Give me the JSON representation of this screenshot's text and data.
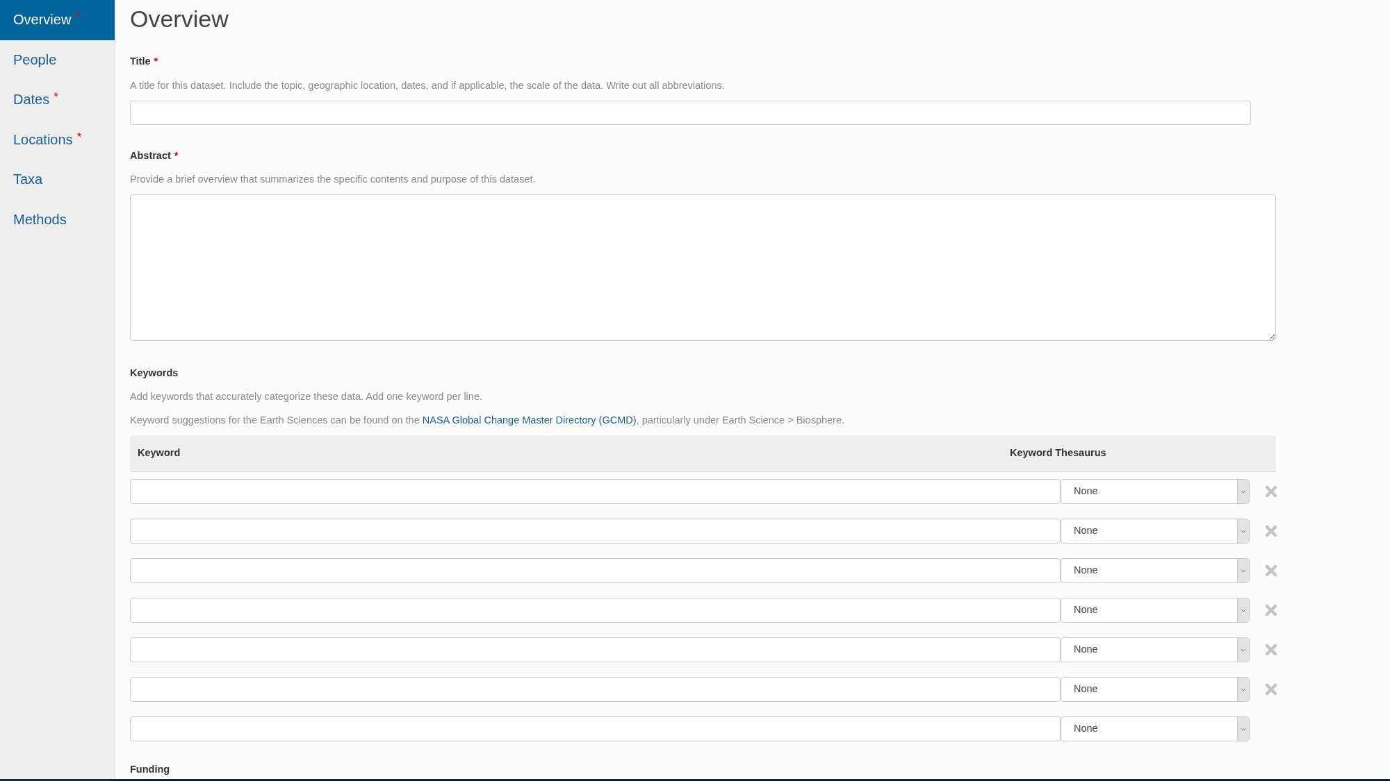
{
  "sidebar": {
    "items": [
      {
        "label": "Overview",
        "required_mark": "*",
        "selected": true
      },
      {
        "label": "People",
        "selected": false
      },
      {
        "label": "Dates",
        "required_mark": "*",
        "selected": false
      },
      {
        "label": "Locations",
        "required_mark": "*",
        "selected": false
      },
      {
        "label": "Taxa",
        "selected": false
      },
      {
        "label": "Methods",
        "selected": false
      }
    ]
  },
  "heading": "Overview",
  "fields": [
    {
      "kind": "input",
      "label": "Title",
      "required_mark": "*",
      "help": [
        "A title for this dataset. Include the topic, geographic location, dates, and if applicable, the scale of the data. Write out all abbreviations."
      ]
    },
    {
      "kind": "textarea",
      "label": "Abstract",
      "required_mark": "*",
      "help": [
        "Provide a brief overview that summarizes the specific contents and purpose of this dataset."
      ]
    }
  ],
  "keywords": {
    "label": "Keywords",
    "help": "Add keywords that accurately categorize these data. Add one keyword per line.",
    "suggestion": {
      "before": "Keyword suggestions for the Earth Sciences can be found on the ",
      "link": "NASA Global Change Master Directory (GCMD)",
      "after": ", particularly under Earth Science > Biosphere."
    },
    "columns": [
      "Keyword",
      "Keyword Thesaurus"
    ],
    "rows": [
      {
        "thesaurus": "None",
        "removable": true
      },
      {
        "thesaurus": "None",
        "removable": true
      },
      {
        "thesaurus": "None",
        "removable": true
      },
      {
        "thesaurus": "None",
        "removable": true
      },
      {
        "thesaurus": "None",
        "removable": true
      },
      {
        "thesaurus": "None",
        "removable": true
      },
      {
        "thesaurus": "None"
      }
    ]
  },
  "next_section": {
    "label": "Funding"
  }
}
